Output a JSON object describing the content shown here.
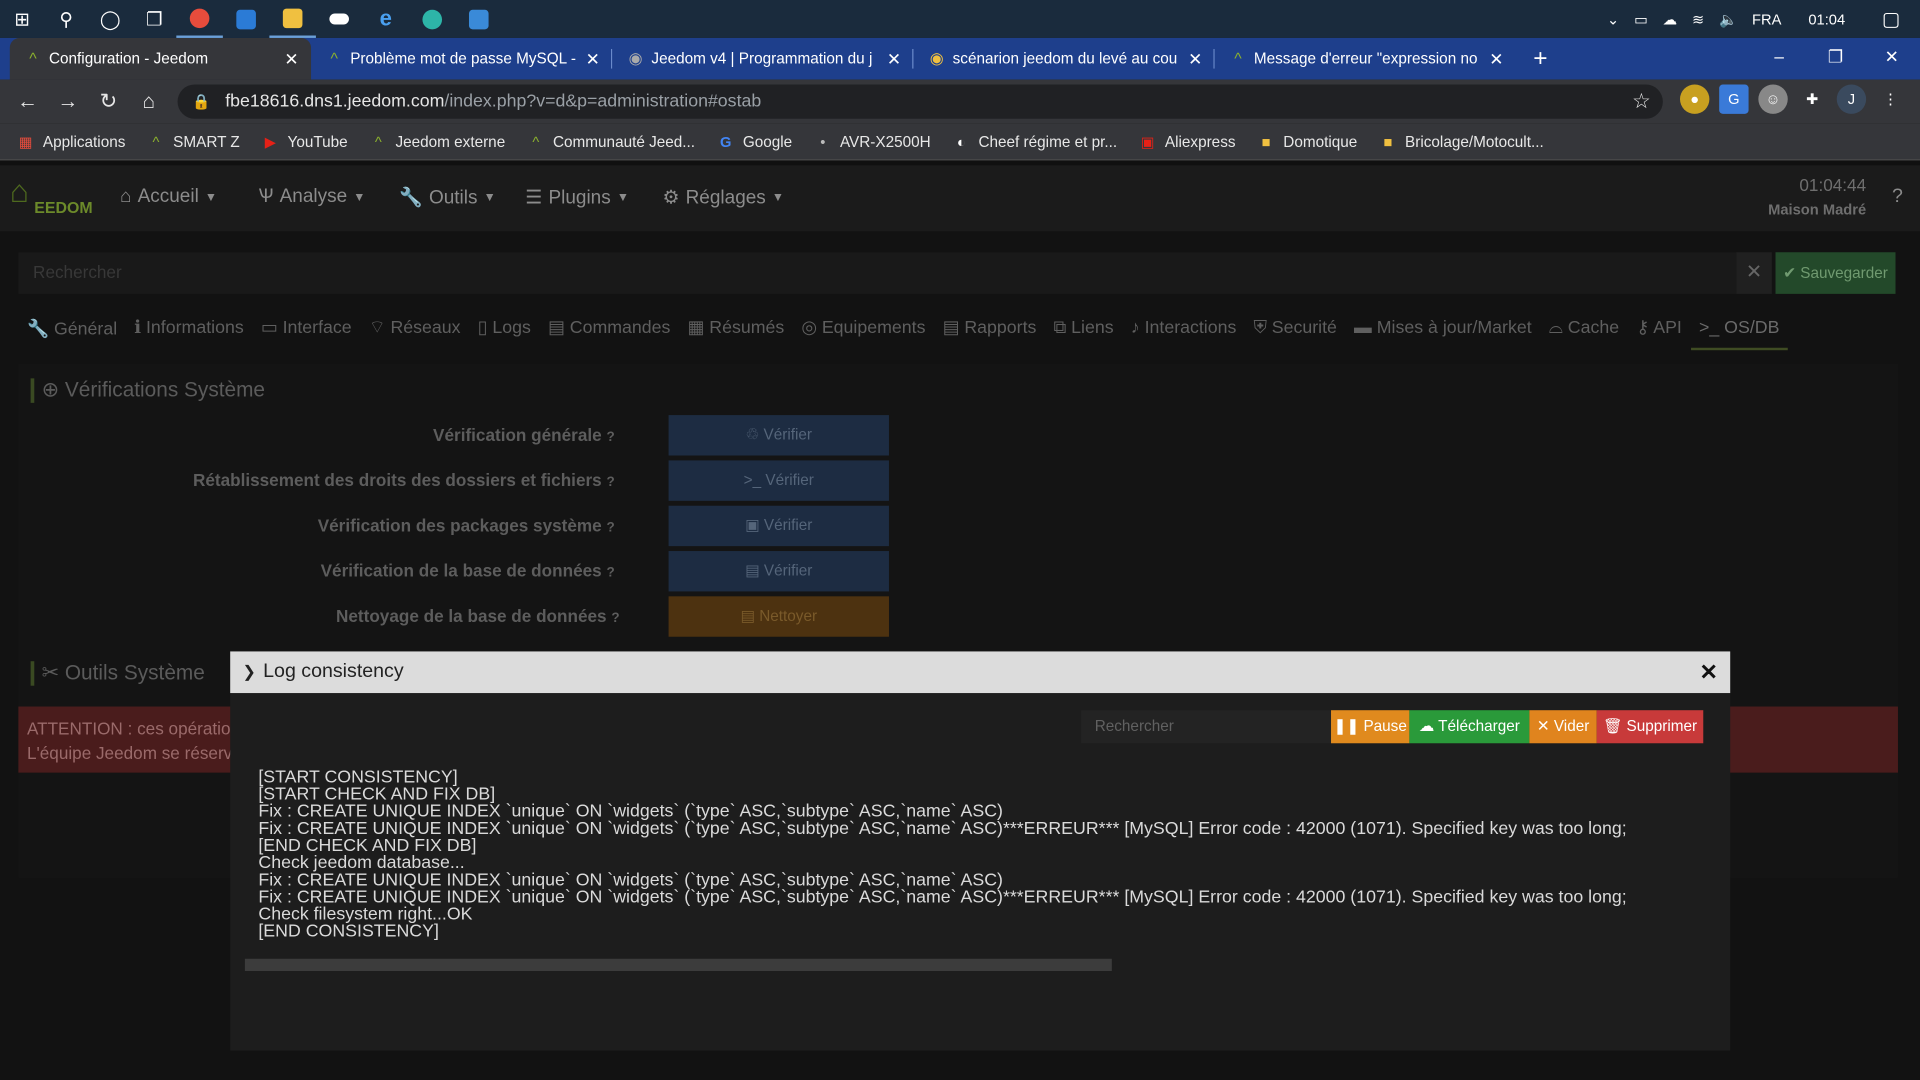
{
  "taskbar": {
    "language": "FRA",
    "time": "01:04"
  },
  "tabs": [
    {
      "title": "Configuration - Jeedom",
      "active": true
    },
    {
      "title": "Problème mot de passe MySQL -"
    },
    {
      "title": "Jeedom v4 | Programmation du j"
    },
    {
      "title": "scénarion jeedom du levé au cou"
    },
    {
      "title": "Message d'erreur \"expression no"
    }
  ],
  "address": {
    "host": "fbe18616.dns1.jeedom.com",
    "path": "/index.php?v=d&p=administration#ostab"
  },
  "bookmarks": [
    "Applications",
    "SMART Z",
    "YouTube",
    "Jeedom externe",
    "Communauté Jeed...",
    "Google",
    "AVR-X2500H",
    "Cheef régime et pr...",
    "Aliexpress",
    "Domotique",
    "Bricolage/Motocult..."
  ],
  "app": {
    "logo": "EEDOM",
    "menu": [
      "Accueil",
      "Analyse",
      "Outils",
      "Plugins",
      "Réglages"
    ],
    "clock": "01:04:44",
    "home_name": "Maison Madré"
  },
  "main": {
    "search_placeholder": "Rechercher",
    "save_label": "Sauvegarder",
    "subtabs": [
      "Général",
      "Informations",
      "Interface",
      "Réseaux",
      "Logs",
      "Commandes",
      "Résumés",
      "Equipements",
      "Rapports",
      "Liens",
      "Interactions",
      "Securité",
      "Mises à jour/Market",
      "Cache",
      "API",
      ">_ OS/DB"
    ],
    "section_checks": "Vérifications Système",
    "checks": [
      {
        "label": "Vérification générale",
        "button": "Vérifier"
      },
      {
        "label": "Rétablissement des droits des dossiers et fichiers",
        "button": "Vérifier"
      },
      {
        "label": "Vérification des packages système",
        "button": "Vérifier"
      },
      {
        "label": "Vérification de la base de données",
        "button": "Vérifier"
      },
      {
        "label": "Nettoyage de la base de données",
        "button": "Nettoyer"
      }
    ],
    "section_tools": "Outils Système",
    "danger_line1": "ATTENTION : ces opératio",
    "danger_line2": "L'équipe Jeedom se réserv"
  },
  "modal": {
    "title": "Log consistency",
    "search_placeholder": "Rechercher",
    "buttons": {
      "pause": "Pause",
      "download": "Télécharger",
      "clear": "Vider",
      "delete": "Supprimer"
    },
    "log": "[START CONSISTENCY]\n[START CHECK AND FIX DB]\nFix : CREATE UNIQUE INDEX `unique` ON `widgets` (`type` ASC,`subtype` ASC,`name` ASC)\nFix : CREATE UNIQUE INDEX `unique` ON `widgets` (`type` ASC,`subtype` ASC,`name` ASC)***ERREUR*** [MySQL] Error code : 42000 (1071). Specified key was too long;\n[END CHECK AND FIX DB]\nCheck jeedom database...\nFix : CREATE UNIQUE INDEX `unique` ON `widgets` (`type` ASC,`subtype` ASC,`name` ASC)\nFix : CREATE UNIQUE INDEX `unique` ON `widgets` (`type` ASC,`subtype` ASC,`name` ASC)***ERREUR*** [MySQL] Error code : 42000 (1071). Specified key was too long;\nCheck filesystem right...OK\n[END CONSISTENCY]"
  },
  "colors": {
    "jeedom_green": "#8ab02e",
    "pause": "#e08a1e",
    "download": "#2a9a3a",
    "clear": "#e0841e",
    "delete": "#c83a3a"
  }
}
